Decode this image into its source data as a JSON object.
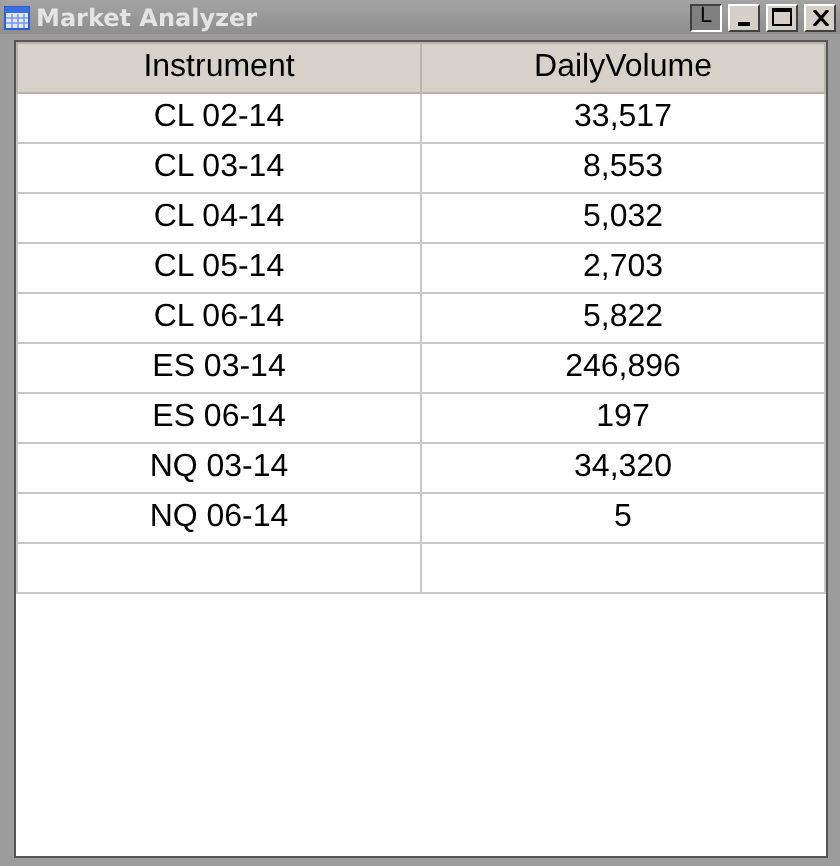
{
  "window": {
    "title": "Market Analyzer",
    "link_button": "L"
  },
  "table": {
    "columns": [
      "Instrument",
      "DailyVolume"
    ],
    "rows": [
      [
        "CL 02-14",
        "33,517"
      ],
      [
        "CL 03-14",
        "8,553"
      ],
      [
        "CL 04-14",
        "5,032"
      ],
      [
        "CL 05-14",
        "2,703"
      ],
      [
        "CL 06-14",
        "5,822"
      ],
      [
        "ES 03-14",
        "246,896"
      ],
      [
        "ES 06-14",
        "197"
      ],
      [
        "NQ 03-14",
        "34,320"
      ],
      [
        "NQ 06-14",
        "5"
      ]
    ]
  }
}
